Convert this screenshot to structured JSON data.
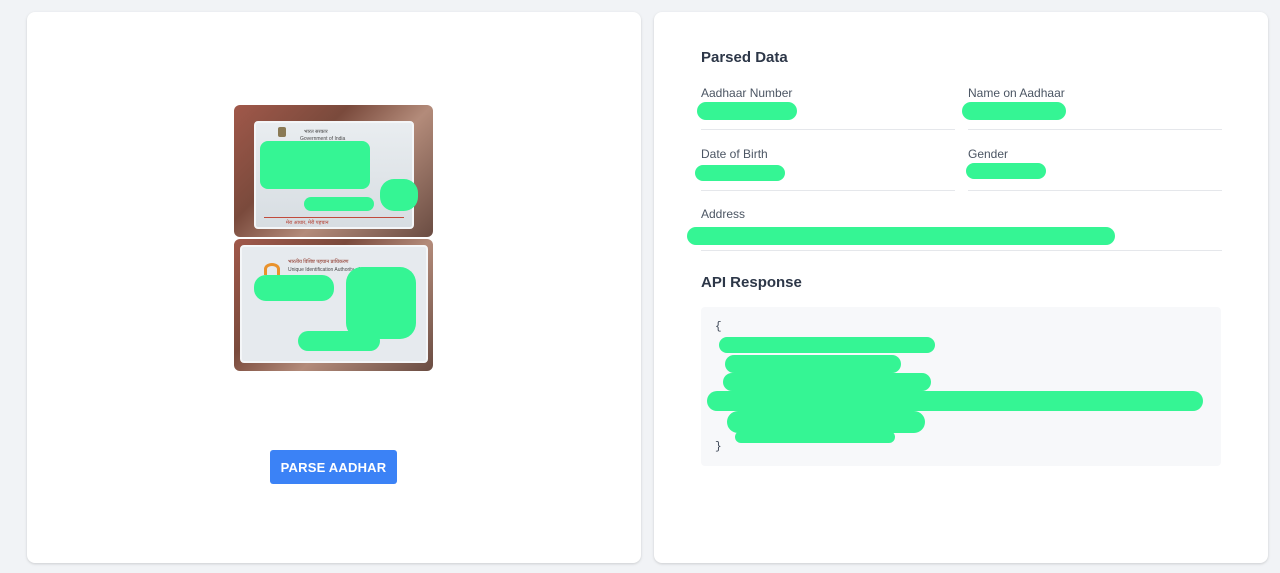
{
  "left_panel": {
    "card_front": {
      "line1": "भारत सरकार",
      "line2": "Government of India",
      "footer": "मेरा आधार, मेरी पहचान"
    },
    "card_back": {
      "line1": "भारतीय विशिष्ट पहचान प्राधिकरण",
      "line2": "Unique Identification Authority of India"
    },
    "parse_button_label": "PARSE AADHAR"
  },
  "right_panel": {
    "parsed_title": "Parsed Data",
    "fields": {
      "aadhaar_number": {
        "label": "Aadhaar Number",
        "value": ""
      },
      "name": {
        "label": "Name on Aadhaar",
        "value": ""
      },
      "dob": {
        "label": "Date of Birth",
        "value": ""
      },
      "gender": {
        "label": "Gender",
        "value": ""
      },
      "address": {
        "label": "Address",
        "value": ""
      }
    },
    "api_title": "API Response",
    "api_response": {
      "open_brace": "{",
      "close_brace": "}"
    }
  },
  "colors": {
    "accent": "#3b82f6",
    "redaction": "#35f594",
    "background": "#f1f3f6"
  }
}
